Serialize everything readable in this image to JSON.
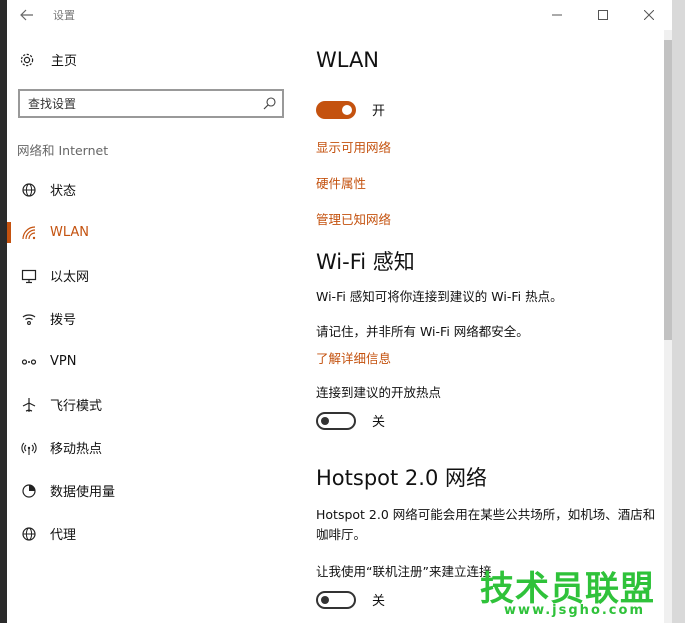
{
  "window": {
    "title": "设置",
    "controls": {
      "minimize": "–",
      "maximize": "☐",
      "close": "✕"
    }
  },
  "sidebar": {
    "home_label": "主页",
    "search_placeholder": "查找设置",
    "section_label": "网络和 Internet",
    "items": [
      {
        "label": "状态",
        "icon": "globe-status-icon"
      },
      {
        "label": "WLAN",
        "icon": "wifi-icon",
        "active": true
      },
      {
        "label": "以太网",
        "icon": "ethernet-icon"
      },
      {
        "label": "拨号",
        "icon": "dialup-icon"
      },
      {
        "label": "VPN",
        "icon": "vpn-icon"
      },
      {
        "label": "飞行模式",
        "icon": "airplane-icon"
      },
      {
        "label": "移动热点",
        "icon": "hotspot-icon"
      },
      {
        "label": "数据使用量",
        "icon": "data-usage-icon"
      },
      {
        "label": "代理",
        "icon": "globe-icon"
      }
    ]
  },
  "main": {
    "wlan_title": "WLAN",
    "wlan_toggle_label": "开",
    "links": [
      "显示可用网络",
      "硬件属性",
      "管理已知网络"
    ],
    "wifi_sense_title": "Wi-Fi 感知",
    "wifi_sense_desc": "Wi-Fi 感知可将你连接到建议的 Wi-Fi 热点。",
    "wifi_sense_note": "请记住，并非所有 Wi-Fi 网络都安全。",
    "learn_more": "了解详细信息",
    "open_hotspot_label": "连接到建议的开放热点",
    "open_hotspot_toggle": "关",
    "hotspot_title": "Hotspot 2.0 网络",
    "hotspot_desc": "Hotspot 2.0 网络可能会用在某些公共场所，如机场、酒店和咖啡厅。",
    "online_signup_label": "让我使用“联机注册”来建立连接",
    "online_signup_toggle": "关"
  },
  "watermark": {
    "main": "技术员联盟",
    "sub": "www.jsgho.com"
  },
  "colors": {
    "accent": "#c4520f",
    "watermark": "#2fc23a"
  }
}
